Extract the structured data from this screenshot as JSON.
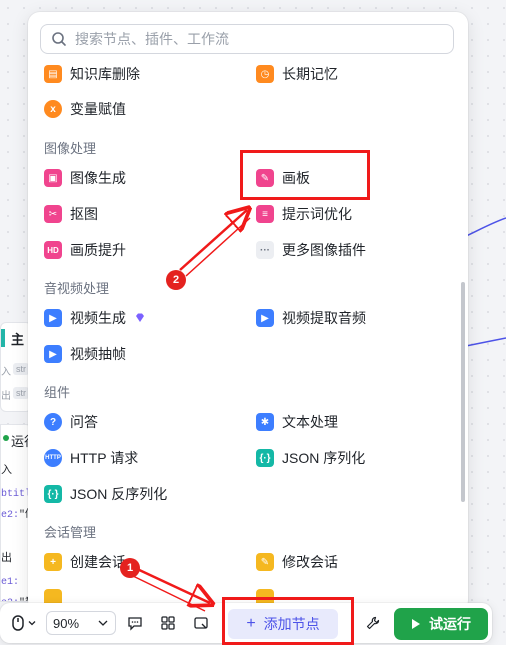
{
  "search": {
    "placeholder": "搜索节点、插件、工作流"
  },
  "sections": [
    {
      "title": "图像处理"
    },
    {
      "title": "音视频处理"
    },
    {
      "title": "组件"
    },
    {
      "title": "会话管理"
    }
  ],
  "items": {
    "knowledge_delete": "知识库删除",
    "long_memory": "长期记忆",
    "var_assign": "变量赋值",
    "image_gen": "图像生成",
    "canvas": "画板",
    "cutout": "抠图",
    "prompt_opt": "提示词优化",
    "quality_up": "画质提升",
    "more_image_plugins": "更多图像插件",
    "video_gen": "视频生成",
    "video_audio_extract": "视频提取音频",
    "video_frame": "视频抽帧",
    "qa": "问答",
    "text_process": "文本处理",
    "http_request": "HTTP 请求",
    "json_serialize": "JSON 序列化",
    "json_deserialize": "JSON 反序列化",
    "create_conversation": "创建会话",
    "modify_conversation": "修改会话"
  },
  "toolbar": {
    "zoom": "90%",
    "add_node": "添加节点",
    "run": "试运行"
  },
  "annotations": {
    "badge1": "1",
    "badge2": "2"
  },
  "canvas_left": {
    "node1_title": "主",
    "node1_tag1": "str",
    "node1_tag2": "str",
    "node1_label1": "入",
    "node1_label2": "出",
    "node2_title": "运行",
    "node2_in": "入",
    "node2_line1_key": "btitle",
    "node2_line2_key": "e2",
    "node2_line2_val": "\"做",
    "node2_out": "出",
    "node2_line3_key": "e1",
    "node2_line4_key": "e2",
    "node2_line4_val": "\"群"
  },
  "colors": {
    "accent": "#4d53e8",
    "run_green": "#20a34a",
    "annotation_red": "#f01a1a"
  }
}
